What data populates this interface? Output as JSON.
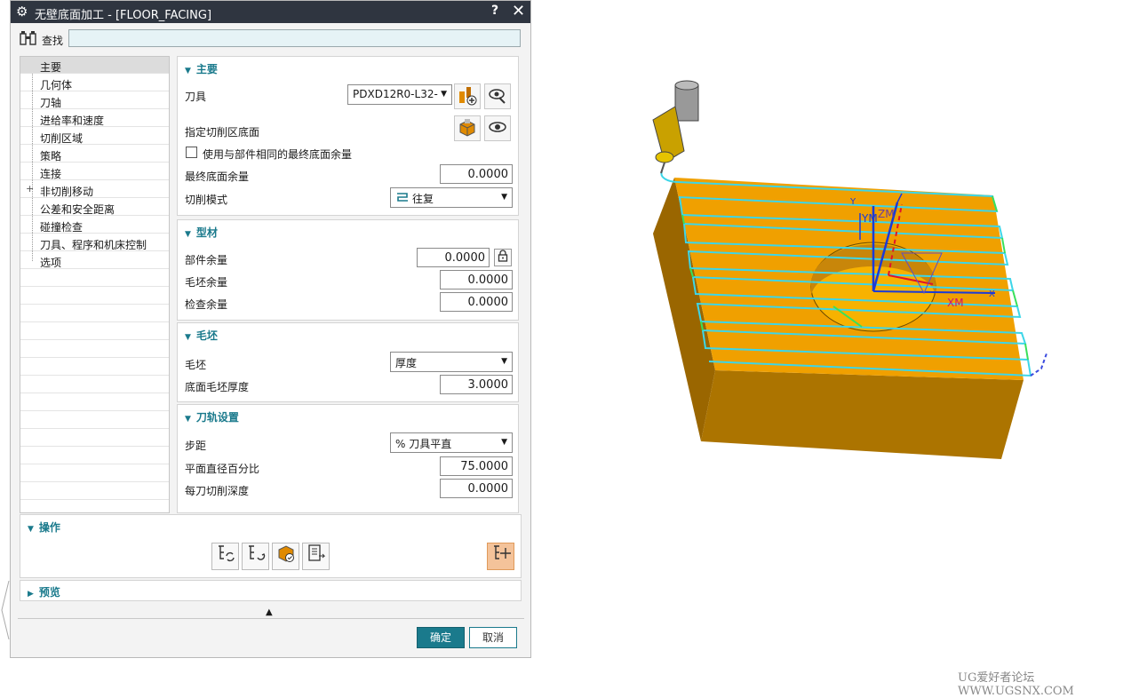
{
  "title": "无壁底面加工 - [FLOOR_FACING]",
  "title_help": "?",
  "title_close": "✕",
  "find": {
    "label": "查找",
    "value": ""
  },
  "nav": [
    "主要",
    "几何体",
    "刀轴",
    "进给率和速度",
    "切削区域",
    "策略",
    "连接",
    "非切削移动",
    "公差和安全距离",
    "碰撞检查",
    "刀具、程序和机床控制",
    "选项"
  ],
  "nav_expand": "+",
  "main": {
    "header": "主要",
    "tool_label": "刀具",
    "tool_value": "PDXD12R0-L32-",
    "floor_label": "指定切削区底面",
    "same_stock_label": "使用与部件相同的最终底面余量",
    "final_floor_label": "最终底面余量",
    "final_floor_value": "0.0000",
    "cut_pattern_label": "切削模式",
    "cut_pattern_value": "往复"
  },
  "stock": {
    "header": "型材",
    "part_label": "部件余量",
    "part_value": "0.0000",
    "blank_label": "毛坯余量",
    "blank_value": "0.0000",
    "check_label": "检查余量",
    "check_value": "0.0000"
  },
  "blank": {
    "header": "毛坯",
    "blank_label": "毛坯",
    "blank_value": "厚度",
    "thickness_label": "底面毛坯厚度",
    "thickness_value": "3.0000"
  },
  "path": {
    "header": "刀轨设置",
    "stepover_label": "步距",
    "stepover_value": "% 刀具平直",
    "percent_label": "平面直径百分比",
    "percent_value": "75.0000",
    "depth_label": "每刀切削深度",
    "depth_value": "0.0000"
  },
  "ops": {
    "header": "操作"
  },
  "preview": {
    "header": "预览"
  },
  "buttons": {
    "ok": "确定",
    "cancel": "取消"
  },
  "viewport_labels": {
    "ym": "YM",
    "zm": "ZM",
    "xm": "XM",
    "x": "X",
    "y": "Y"
  },
  "watermark": "UG爱好者论坛 WWW.UGSNX.COM",
  "colors": {
    "accent": "#1a7a8c",
    "titlebar": "#2f3540",
    "ok": "#1a7a8c",
    "part": "#f0a000",
    "toolpath": "#3dd6e8"
  }
}
